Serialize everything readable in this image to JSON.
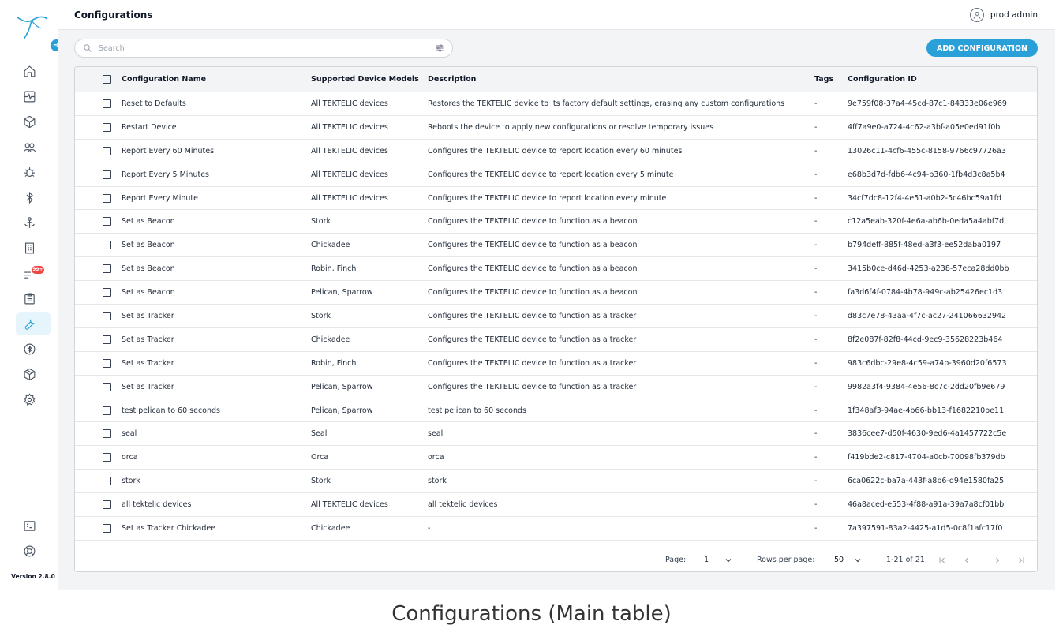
{
  "header": {
    "title": "Configurations",
    "user_name": "prod admin"
  },
  "sidebar": {
    "version": "Version 2.8.0",
    "notification_badge": "99+",
    "items": [
      {
        "icon": "home-icon"
      },
      {
        "icon": "dashboard-icon"
      },
      {
        "icon": "cube-icon"
      },
      {
        "icon": "users-icon"
      },
      {
        "icon": "bug-icon"
      },
      {
        "icon": "bluetooth-icon"
      },
      {
        "icon": "anchor-icon"
      },
      {
        "icon": "building-icon"
      },
      {
        "icon": "alerts-list-icon"
      },
      {
        "icon": "clipboard-icon"
      },
      {
        "icon": "wrench-icon",
        "active": true
      },
      {
        "icon": "bluetooth-circle-icon"
      },
      {
        "icon": "package-icon"
      },
      {
        "icon": "settings-gear-icon"
      }
    ]
  },
  "toolbar": {
    "search_placeholder": "Search",
    "add_label": "ADD CONFIGURATION"
  },
  "table": {
    "columns": [
      "Configuration Name",
      "Supported Device Models",
      "Description",
      "Tags",
      "Configuration ID"
    ],
    "rows": [
      [
        "Reset to Defaults",
        "All TEKTELIC devices",
        "Restores the TEKTELIC device to its factory default settings, erasing any custom configurations",
        "-",
        "9e759f08-37a4-45cd-87c1-84333e06e969"
      ],
      [
        "Restart Device",
        "All TEKTELIC devices",
        "Reboots the device to apply new configurations or resolve temporary issues",
        "-",
        "4ff7a9e0-a724-4c62-a3bf-a05e0ed91f0b"
      ],
      [
        "Report Every 60 Minutes",
        "All TEKTELIC devices",
        "Configures the TEKTELIC device to report location every 60 minutes",
        "-",
        "13026c11-4cf6-455c-8158-9766c97726a3"
      ],
      [
        "Report Every 5 Minutes",
        "All TEKTELIC devices",
        "Configures the TEKTELIC device to report location every 5 minute",
        "-",
        "e68b3d7d-fdb6-4c94-b360-1fb4d3c8a5b4"
      ],
      [
        "Report Every Minute",
        "All TEKTELIC devices",
        "Configures the TEKTELIC device to report location every minute",
        "-",
        "34cf7dc8-12f4-4e51-a0b2-5c46bc59a1fd"
      ],
      [
        "Set as Beacon",
        "Stork",
        "Configures the TEKTELIC device to function as a beacon",
        "-",
        "c12a5eab-320f-4e6a-ab6b-0eda5a4abf7d"
      ],
      [
        "Set as Beacon",
        "Chickadee",
        "Configures the TEKTELIC device to function as a beacon",
        "-",
        "b794deff-885f-48ed-a3f3-ee52daba0197"
      ],
      [
        "Set as Beacon",
        "Robin, Finch",
        "Configures the TEKTELIC device to function as a beacon",
        "-",
        "3415b0ce-d46d-4253-a238-57eca28dd0bb"
      ],
      [
        "Set as Beacon",
        "Pelican, Sparrow",
        "Configures the TEKTELIC device to function as a beacon",
        "-",
        "fa3d6f4f-0784-4b78-949c-ab25426ec1d3"
      ],
      [
        "Set as Tracker",
        "Stork",
        "Configures the TEKTELIC device to function as a tracker",
        "-",
        "d83c7e78-43aa-4f7c-ac27-241066632942"
      ],
      [
        "Set as Tracker",
        "Chickadee",
        "Configures the TEKTELIC device to function as a tracker",
        "-",
        "8f2e087f-82f8-44cd-9ec9-35628223b464"
      ],
      [
        "Set as Tracker",
        "Robin, Finch",
        "Configures the TEKTELIC device to function as a tracker",
        "-",
        "983c6dbc-29e8-4c59-a74b-3960d20f6573"
      ],
      [
        "Set as Tracker",
        "Pelican, Sparrow",
        "Configures the TEKTELIC device to function as a tracker",
        "-",
        "9982a3f4-9384-4e56-8c7c-2dd20fb9e679"
      ],
      [
        "test pelican to 60 seconds",
        "Pelican, Sparrow",
        "test pelican to 60 seconds",
        "-",
        "1f348af3-94ae-4b66-bb13-f1682210be11"
      ],
      [
        "seal",
        "Seal",
        "seal",
        "-",
        "3836cee7-d50f-4630-9ed6-4a1457722c5e"
      ],
      [
        "orca",
        "Orca",
        "orca",
        "-",
        "f419bde2-c817-4704-a0cb-70098fb379db"
      ],
      [
        "stork",
        "Stork",
        "stork",
        "-",
        "6ca0622c-ba7a-443f-a8b6-d94e1580fa25"
      ],
      [
        "all tektelic devices",
        "All TEKTELIC devices",
        "all tektelic devices",
        "-",
        "46a8aced-e553-4f88-a91a-39a7a8cf01bb"
      ],
      [
        "Set as Tracker Chickadee",
        "Chickadee",
        "-",
        "-",
        "7a397591-83a2-4425-a1d5-0c8f1afc17f0"
      ]
    ]
  },
  "pagination": {
    "page_label": "Page:",
    "page_value": "1",
    "rows_label": "Rows per page:",
    "rows_value": "50",
    "range": "1-21 of 21"
  },
  "caption": "Configurations (Main table)"
}
